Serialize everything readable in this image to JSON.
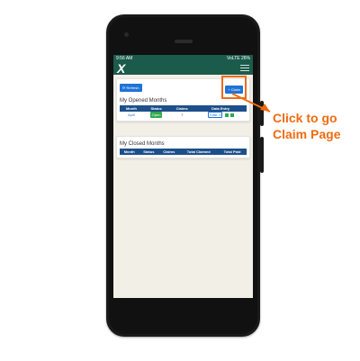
{
  "status_bar": {
    "time": "9:56 AM",
    "right": "VoLTE 26%"
  },
  "app": {
    "logo": "X",
    "logo_sub": ""
  },
  "toolbar": {
    "refresh_label": "Refresh",
    "claim_label": "+ Claim"
  },
  "opened": {
    "title": "My Opened Months",
    "headers": [
      "Month",
      "Status",
      "Claims",
      "Data Entry"
    ],
    "rows": [
      {
        "month": "April",
        "status": "Open",
        "claims": "?",
        "total": "Total: 9"
      }
    ]
  },
  "closed": {
    "title": "My Closed Months",
    "headers": [
      "Month",
      "Status",
      "Claims",
      "Total Claimed",
      "Total Paid"
    ]
  },
  "annotation": {
    "line1": "Click to go",
    "line2": "Claim Page",
    "color": "#ef6b0f"
  }
}
